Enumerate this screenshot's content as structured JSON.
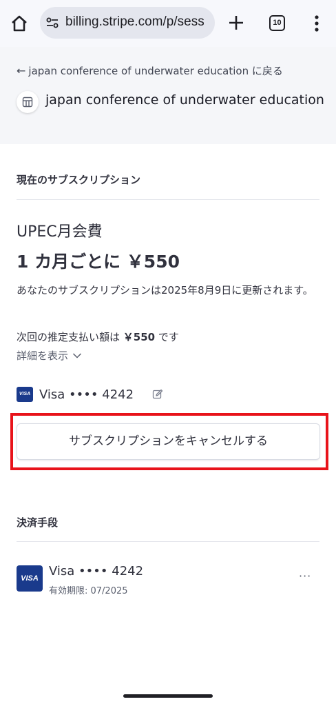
{
  "browser": {
    "url": "billing.stripe.com/p/sess",
    "tab_count": "10",
    "icons": {
      "home": "home-icon",
      "site_info": "tune-icon",
      "new_tab": "plus-icon",
      "tabs": "tabs-icon",
      "menu": "more-vert-icon"
    }
  },
  "header": {
    "back_label": "japan conference of underwater education に戻る",
    "merchant_name": "japan conference of underwater education"
  },
  "subscription": {
    "section_title": "現在のサブスクリプション",
    "plan_name": "UPEC月会費",
    "price": "1 カ月ごとに ￥550",
    "renewal_text": "あなたのサブスクリプションは2025年8月9日に更新されます。",
    "next_payment_prefix": "次回の推定支払い額は",
    "next_payment_amount": "￥550",
    "next_payment_suffix": "です",
    "details_label": "詳細を表示",
    "card_brand": "VISA",
    "card_label": "Visa •••• 4242",
    "cancel_button": "サブスクリプションをキャンセルする"
  },
  "payment_methods": {
    "section_title": "決済手段",
    "items": [
      {
        "brand": "VISA",
        "label": "Visa •••• 4242",
        "expiry": "有効期限: 07/2025",
        "more": "···"
      }
    ]
  },
  "colors": {
    "accent_red": "#e8131a",
    "visa_blue": "#1a3a8c",
    "header_bg": "#f5f6f9"
  }
}
